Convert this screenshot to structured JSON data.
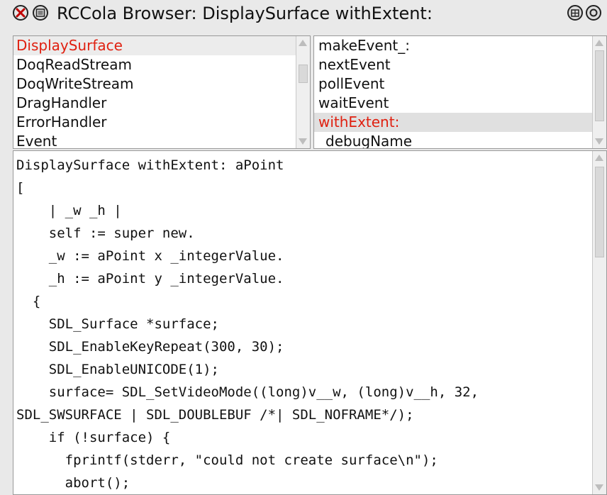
{
  "window": {
    "title": "RCCola Browser: DisplaySurface withExtent:"
  },
  "icons": {
    "close": "close-icon",
    "menu": "window-menu-icon",
    "collapse": "collapse-icon",
    "expand": "expand-icon"
  },
  "classes": {
    "selected": "DisplaySurface",
    "items": [
      "DisplaySurface",
      "DoqReadStream",
      "DoqWriteStream",
      "DragHandler",
      "ErrorHandler",
      "Event"
    ]
  },
  "methods": {
    "selected": "withExtent:",
    "items": [
      "makeEvent_:",
      "nextEvent",
      "pollEvent",
      "waitEvent",
      "withExtent:",
      "_debugName"
    ]
  },
  "code": {
    "lines": [
      "DisplaySurface withExtent: aPoint",
      "[",
      "    | _w _h |",
      "    self := super new.",
      "    _w := aPoint x _integerValue.",
      "    _h := aPoint y _integerValue.",
      "  {",
      "    SDL_Surface *surface;",
      "    SDL_EnableKeyRepeat(300, 30);",
      "    SDL_EnableUNICODE(1);",
      "    surface= SDL_SetVideoMode((long)v__w, (long)v__h, 32,",
      "SDL_SWSURFACE | SDL_DOUBLEBUF /*| SDL_NOFRAME*/);",
      "    if (!surface) {",
      "      fprintf(stderr, \"could not create surface\\n\");",
      "      abort();",
      "    }"
    ]
  },
  "colors": {
    "selection_text": "#e02010",
    "background": "#e9e9e9"
  }
}
